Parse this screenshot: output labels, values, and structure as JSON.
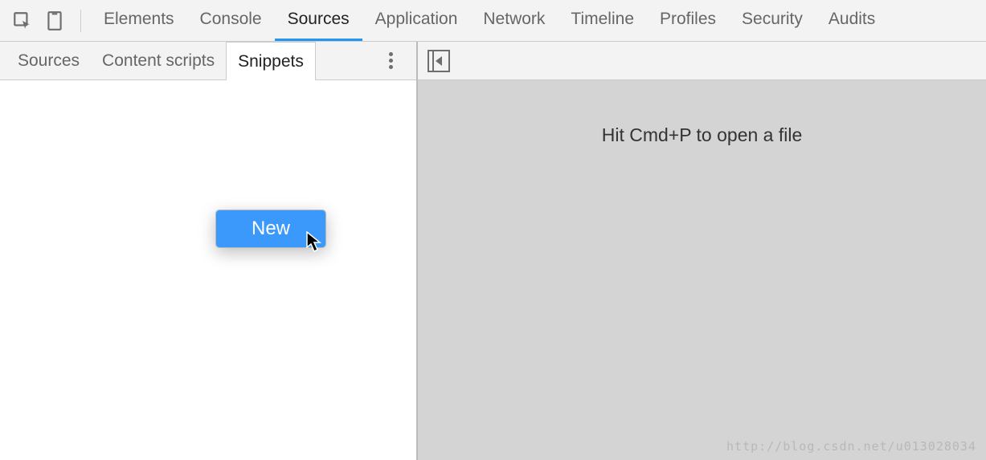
{
  "toolbar": {
    "tabs": [
      {
        "label": "Elements",
        "active": false
      },
      {
        "label": "Console",
        "active": false
      },
      {
        "label": "Sources",
        "active": true
      },
      {
        "label": "Application",
        "active": false
      },
      {
        "label": "Network",
        "active": false
      },
      {
        "label": "Timeline",
        "active": false
      },
      {
        "label": "Profiles",
        "active": false
      },
      {
        "label": "Security",
        "active": false
      },
      {
        "label": "Audits",
        "active": false
      }
    ]
  },
  "left_panel": {
    "sub_tabs": [
      {
        "label": "Sources",
        "active": false
      },
      {
        "label": "Content scripts",
        "active": false
      },
      {
        "label": "Snippets",
        "active": true
      }
    ],
    "context_menu": {
      "items": [
        {
          "label": "New"
        }
      ]
    }
  },
  "right_panel": {
    "hint": "Hit Cmd+P to open a file"
  },
  "watermark": "http://blog.csdn.net/u013028034"
}
